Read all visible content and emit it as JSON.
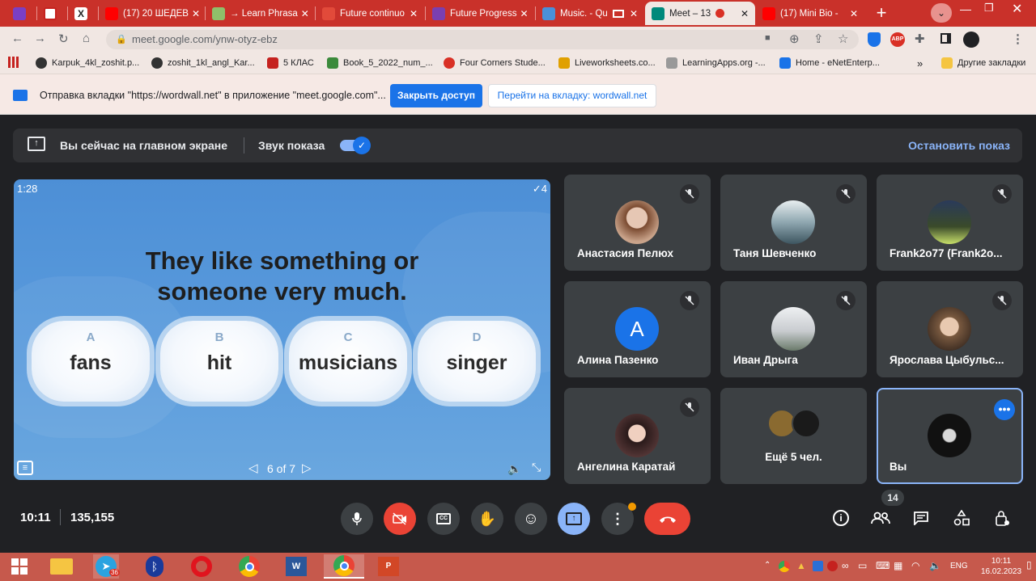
{
  "tabs": [
    {
      "label": "",
      "color": "#7b3fc4"
    },
    {
      "label": "",
      "color": "#c5221f"
    },
    {
      "label": "",
      "color": "#222222"
    },
    {
      "label": "(17) 20 ШЕДЕВ",
      "color": "#ff0000"
    },
    {
      "label": "→ Learn Phrasa",
      "color": "#8fbf6a"
    },
    {
      "label": "Future continuo",
      "color": "#e24a3a"
    },
    {
      "label": "Future Progress",
      "color": "#7a3fb0"
    },
    {
      "label": "Music. - Qu",
      "color": "#4a90d9"
    },
    {
      "label": "Meet – 13",
      "color": "#00897b"
    },
    {
      "label": "(17) Mini Bio -",
      "color": "#ff0000"
    }
  ],
  "address": {
    "url": "meet.google.com/ynw-otyz-ebz"
  },
  "bookmarks": [
    {
      "label": "Karpuk_4kl_zoshit.p...",
      "color": "#333"
    },
    {
      "label": "zoshit_1kl_angl_Kar...",
      "color": "#333"
    },
    {
      "label": "5 КЛАС",
      "color": "#c5221f"
    },
    {
      "label": "Book_5_2022_num_...",
      "color": "#3b8a3b"
    },
    {
      "label": "Four Corners Stude...",
      "color": "#d93025"
    },
    {
      "label": "Liveworksheets.co...",
      "color": "#e0a000"
    },
    {
      "label": "LearningApps.org -...",
      "color": "#666"
    },
    {
      "label": "Home - eNetEnterp...",
      "color": "#1a73e8"
    }
  ],
  "bookmarks_other": "Другие закладки",
  "infobar": {
    "text": "Отправка вкладки \"https://wordwall.net\" в приложение \"meet.google.com\"...",
    "allow_label": "Закрыть доступ",
    "switch_label": "Перейти на вкладку: wordwall.net"
  },
  "presenting": {
    "main_text": "Вы сейчас на главном экране",
    "sound_label": "Звук показа",
    "stop_label": "Остановить показ"
  },
  "slide": {
    "timer": "1:28",
    "score": "✓4",
    "question_line1": "They like something or",
    "question_line2": "someone very much.",
    "options": [
      {
        "letter": "A",
        "word": "fans"
      },
      {
        "letter": "B",
        "word": "hit"
      },
      {
        "letter": "C",
        "word": "musicians"
      },
      {
        "letter": "D",
        "word": "singer"
      }
    ],
    "page": "6 of 7"
  },
  "participants": [
    {
      "name": "Анастасия Пелюх",
      "avatar": "#c9a38a"
    },
    {
      "name": "Таня Шевченко",
      "avatar": "#8fa7b0"
    },
    {
      "name": "Frank2o77 (Frank2o...",
      "avatar": "#3a4a2a"
    },
    {
      "name": "Алина Пазенко",
      "avatar": "#1a73e8",
      "initial": "A"
    },
    {
      "name": "Иван Дрыга",
      "avatar": "#c9ccd0"
    },
    {
      "name": "Ярослава Цыбульс...",
      "avatar": "#7a5a40"
    },
    {
      "name": "Ангелина Каратай",
      "avatar": "#5a3a3a"
    },
    {
      "name": "Ещё 5 чел.",
      "avatar": "#8a6a30"
    },
    {
      "name": "Вы",
      "avatar": "#111111"
    }
  ],
  "meeting": {
    "time": "10:11",
    "code": "135,155",
    "people_count": "14"
  },
  "taskbar": {
    "lang": "ENG",
    "time": "10:11",
    "date": "16.02.2023",
    "telegram_badge": "36"
  }
}
